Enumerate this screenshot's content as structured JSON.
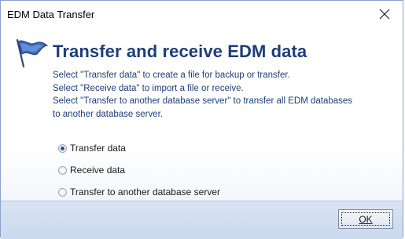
{
  "window": {
    "title": "EDM Data Transfer",
    "close_icon": "close-icon"
  },
  "main": {
    "heading": "Transfer and receive EDM data",
    "icon": "flag-icon",
    "description": [
      "Select \"Transfer data\" to create a file for backup or transfer.",
      "Select \"Receive data\" to import a file or receive.",
      "Select \"Transfer to another database server\" to transfer all EDM databases",
      "to another database server."
    ]
  },
  "options": [
    {
      "label": "Transfer data",
      "selected": true
    },
    {
      "label": "Receive data",
      "selected": false
    },
    {
      "label": "Transfer to another database server",
      "selected": false
    }
  ],
  "footer": {
    "ok_label": "OK"
  },
  "colors": {
    "heading": "#1e3d78",
    "footer_bg": "#cbd9ee"
  }
}
